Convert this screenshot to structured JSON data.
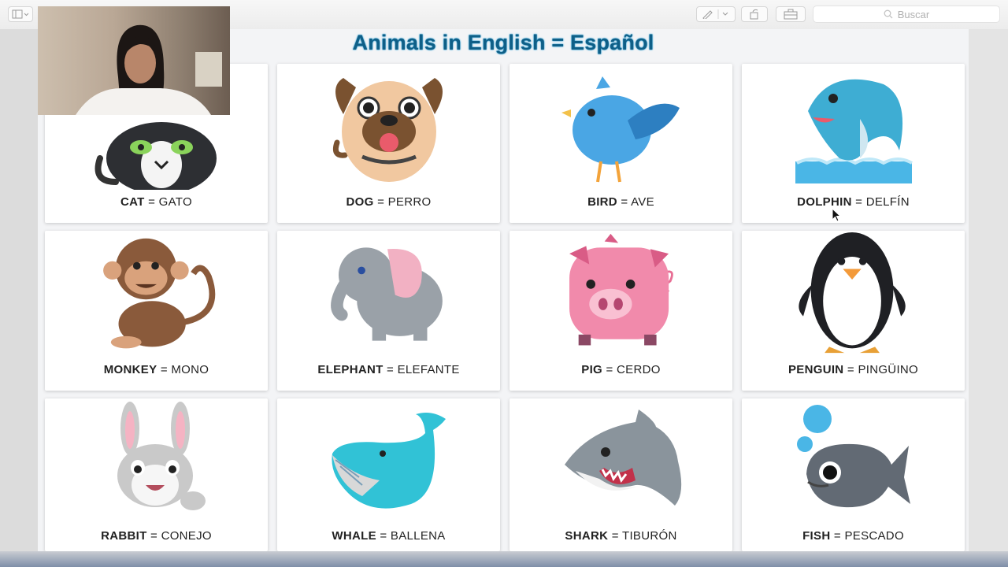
{
  "toolbar": {
    "search_placeholder": "Buscar",
    "sidebar_icon": "sidebar-icon",
    "pen_icon": "pen-icon",
    "rotate_icon": "rotate-icon",
    "briefcase_icon": "toolbox-icon"
  },
  "page": {
    "title": "Animals in English = Español"
  },
  "cards": [
    {
      "english": "CAT",
      "sep": " = ",
      "spanish": "GATO",
      "icon": "cat-icon"
    },
    {
      "english": "DOG",
      "sep": " = ",
      "spanish": "PERRO",
      "icon": "dog-icon"
    },
    {
      "english": "BIRD",
      "sep": " = ",
      "spanish": "AVE",
      "icon": "bird-icon"
    },
    {
      "english": "DOLPHIN",
      "sep": " = ",
      "spanish": "DELFÍN",
      "icon": "dolphin-icon"
    },
    {
      "english": "MONKEY",
      "sep": " = ",
      "spanish": "MONO",
      "icon": "monkey-icon"
    },
    {
      "english": "ELEPHANT",
      "sep": " = ",
      "spanish": "ELEFANTE",
      "icon": "elephant-icon"
    },
    {
      "english": "PIG",
      "sep": " = ",
      "spanish": "CERDO",
      "icon": "pig-icon"
    },
    {
      "english": "PENGUIN",
      "sep": " = ",
      "spanish": "PINGÜINO",
      "icon": "penguin-icon"
    },
    {
      "english": "RABBIT",
      "sep": " = ",
      "spanish": "CONEJO",
      "icon": "rabbit-icon"
    },
    {
      "english": "WHALE",
      "sep": " = ",
      "spanish": "BALLENA",
      "icon": "whale-icon"
    },
    {
      "english": "SHARK",
      "sep": " = ",
      "spanish": "TIBURÓN",
      "icon": "shark-icon"
    },
    {
      "english": "FISH",
      "sep": " = ",
      "spanish": "PESCADO",
      "icon": "fish-icon"
    }
  ],
  "colors": {
    "title": "#0f5f87",
    "card_bg": "#ffffff",
    "page_bg": "#f3f4f6"
  }
}
